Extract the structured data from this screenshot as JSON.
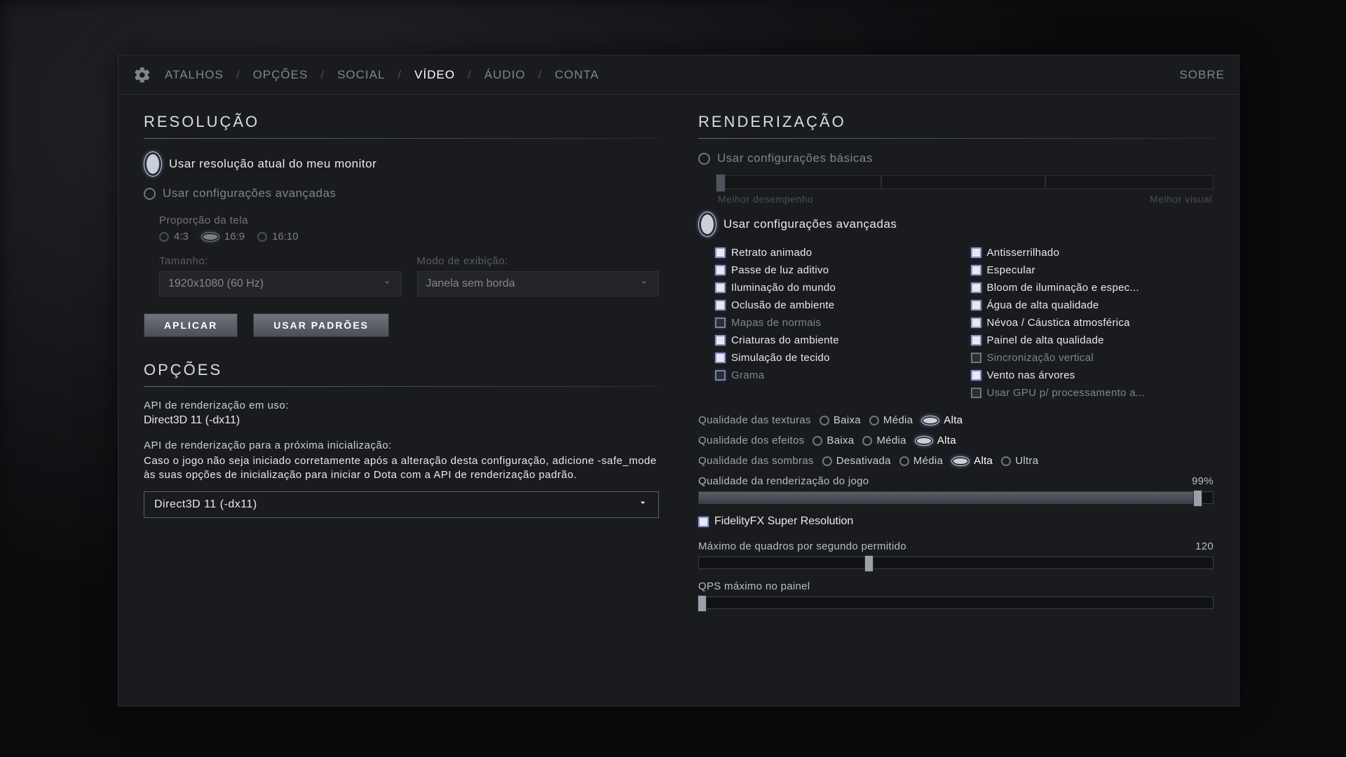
{
  "tabs": {
    "atalhos": "ATALHOS",
    "opcoes": "OPÇÕES",
    "social": "SOCIAL",
    "video": "VÍDEO",
    "audio": "ÁUDIO",
    "conta": "CONTA",
    "sobre": "SOBRE"
  },
  "resolution": {
    "title": "RESOLUÇÃO",
    "use_monitor": "Usar resolução atual do meu monitor",
    "use_advanced": "Usar configurações avançadas",
    "aspect_label": "Proporção da tela",
    "aspects": {
      "a43": "4:3",
      "a169": "16:9",
      "a1610": "16:10"
    },
    "size_label": "Tamanho:",
    "size_value": "1920x1080 (60 Hz)",
    "mode_label": "Modo de exibição:",
    "mode_value": "Janela sem borda",
    "apply": "APLICAR",
    "defaults": "USAR PADRÕES"
  },
  "options": {
    "title": "OPÇÕES",
    "api_in_use_label": "API de renderização em uso:",
    "api_in_use_value": "Direct3D 11 (-dx11)",
    "api_next_label": "API de renderização para a próxima inicialização:",
    "api_next_desc": "Caso o jogo não seja iniciado corretamente após a alteração desta configuração, adicione -safe_mode às suas opções de inicialização para iniciar o Dota com a API de renderização padrão.",
    "api_select": "Direct3D 11 (-dx11)"
  },
  "render": {
    "title": "RENDERIZAÇÃO",
    "basic": "Usar configurações básicas",
    "slider_low": "Melhor desempenho",
    "slider_high": "Melhor visual",
    "advanced": "Usar configurações avançadas",
    "checks_left": [
      {
        "label": "Retrato animado",
        "on": true
      },
      {
        "label": "Passe de luz aditivo",
        "on": true
      },
      {
        "label": "Iluminação do mundo",
        "on": true
      },
      {
        "label": "Oclusão de ambiente",
        "on": true
      },
      {
        "label": "Mapas de normais",
        "on": false,
        "dim": true
      },
      {
        "label": "Criaturas do ambiente",
        "on": true
      },
      {
        "label": "Simulação de tecido",
        "on": true
      },
      {
        "label": "Grama",
        "on": false,
        "dim": true
      }
    ],
    "checks_right": [
      {
        "label": "Antisserrilhado",
        "on": true
      },
      {
        "label": "Especular",
        "on": true
      },
      {
        "label": "Bloom de iluminação e espec...",
        "on": true
      },
      {
        "label": "Água de alta qualidade",
        "on": true
      },
      {
        "label": "Névoa / Cáustica atmosférica",
        "on": true
      },
      {
        "label": "Painel de alta qualidade",
        "on": true
      },
      {
        "label": "Sincronização vertical",
        "on": false,
        "dim": true,
        "plain": true
      },
      {
        "label": "Vento nas árvores",
        "on": true
      },
      {
        "label": "Usar GPU p/ processamento a...",
        "on": false,
        "dim": true,
        "plain": true
      }
    ],
    "tex_label": "Qualidade das texturas",
    "tex_opts": [
      "Baixa",
      "Média",
      "Alta"
    ],
    "tex_sel": 2,
    "fx_label": "Qualidade dos efeitos",
    "fx_opts": [
      "Baixa",
      "Média",
      "Alta"
    ],
    "fx_sel": 2,
    "sh_label": "Qualidade das sombras",
    "sh_opts": [
      "Desativada",
      "Média",
      "Alta",
      "Ultra"
    ],
    "sh_sel": 2,
    "rq_label": "Qualidade da renderização do jogo",
    "rq_value": "99%",
    "fsr": "FidelityFX Super Resolution",
    "fps_label": "Máximo de quadros por segundo permitido",
    "fps_value": "120",
    "qps_label": "QPS máximo no painel"
  }
}
